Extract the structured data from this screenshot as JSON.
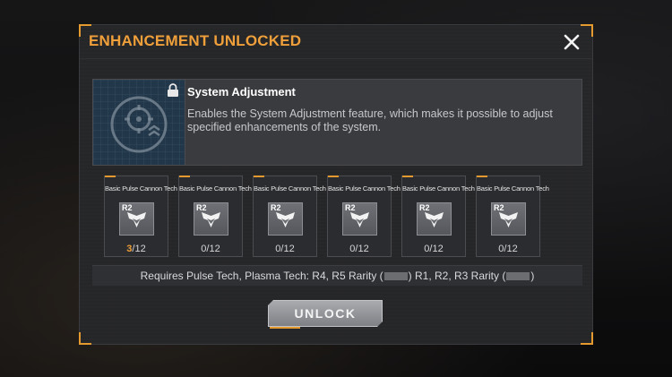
{
  "dialog": {
    "title": "ENHANCEMENT UNLOCKED",
    "close_icon": "close-icon"
  },
  "feature": {
    "title": "System Adjustment",
    "description": "Enables the System Adjustment feature, which makes it possible to adjust specified enhancements of the system.",
    "icon": "system-adjustment-icon",
    "locked": true
  },
  "techs": [
    {
      "name": "Basic Pulse Cannon Tech",
      "rank": "R2",
      "current": "3",
      "total": "/12",
      "highlight": true
    },
    {
      "name": "Basic Pulse Cannon Tech",
      "rank": "R2",
      "current": "0",
      "total": "/12",
      "highlight": false
    },
    {
      "name": "Basic Pulse Cannon Tech",
      "rank": "R2",
      "current": "0",
      "total": "/12",
      "highlight": false
    },
    {
      "name": "Basic Pulse Cannon Tech",
      "rank": "R2",
      "current": "0",
      "total": "/12",
      "highlight": false
    },
    {
      "name": "Basic Pulse Cannon Tech",
      "rank": "R2",
      "current": "0",
      "total": "/12",
      "highlight": false
    },
    {
      "name": "Basic Pulse Cannon Tech",
      "rank": "R2",
      "current": "0",
      "total": "/12",
      "highlight": false
    }
  ],
  "requirement": {
    "part1": "Requires Pulse Tech, Plasma Tech: R4, R5 Rarity (",
    "part2": ") R1, R2, R3 Rarity (",
    "part3": ")"
  },
  "unlock_button": {
    "label": "UNLOCK"
  },
  "colors": {
    "accent": "#e59a2f",
    "title": "#f0a03a",
    "panel": "#252628"
  }
}
